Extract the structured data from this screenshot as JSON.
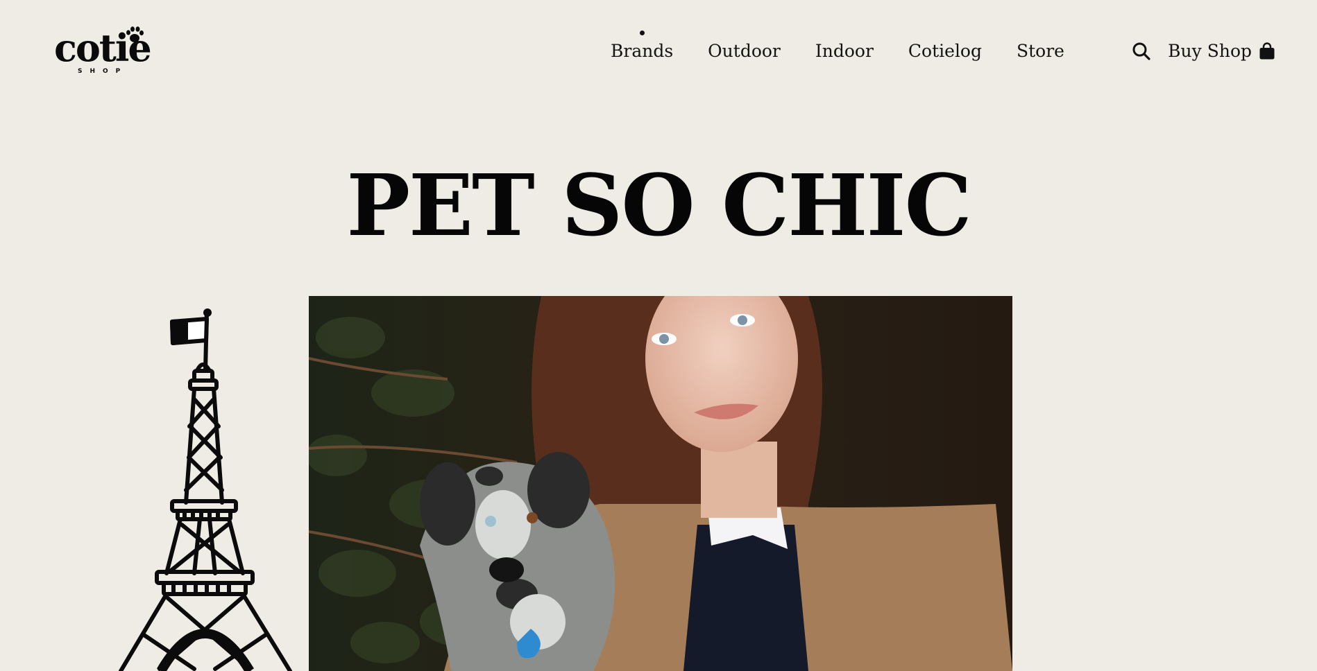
{
  "brand": {
    "name": "cotie",
    "tagline": "SHOP"
  },
  "nav": {
    "items": [
      {
        "label": "Brands",
        "active": true
      },
      {
        "label": "Outdoor",
        "active": false
      },
      {
        "label": "Indoor",
        "active": false
      },
      {
        "label": "Cotielog",
        "active": false
      },
      {
        "label": "Store",
        "active": false
      }
    ]
  },
  "utilities": {
    "search_icon": "search-icon",
    "cart_label": "Buy Shop",
    "cart_icon": "shopping-bag-icon"
  },
  "hero": {
    "title": "PET SO CHIC",
    "image": "woman-holding-merle-puppy-photo",
    "illustration": "eiffel-tower-drawing"
  },
  "colors": {
    "background": "#efece5",
    "text": "#111111"
  }
}
